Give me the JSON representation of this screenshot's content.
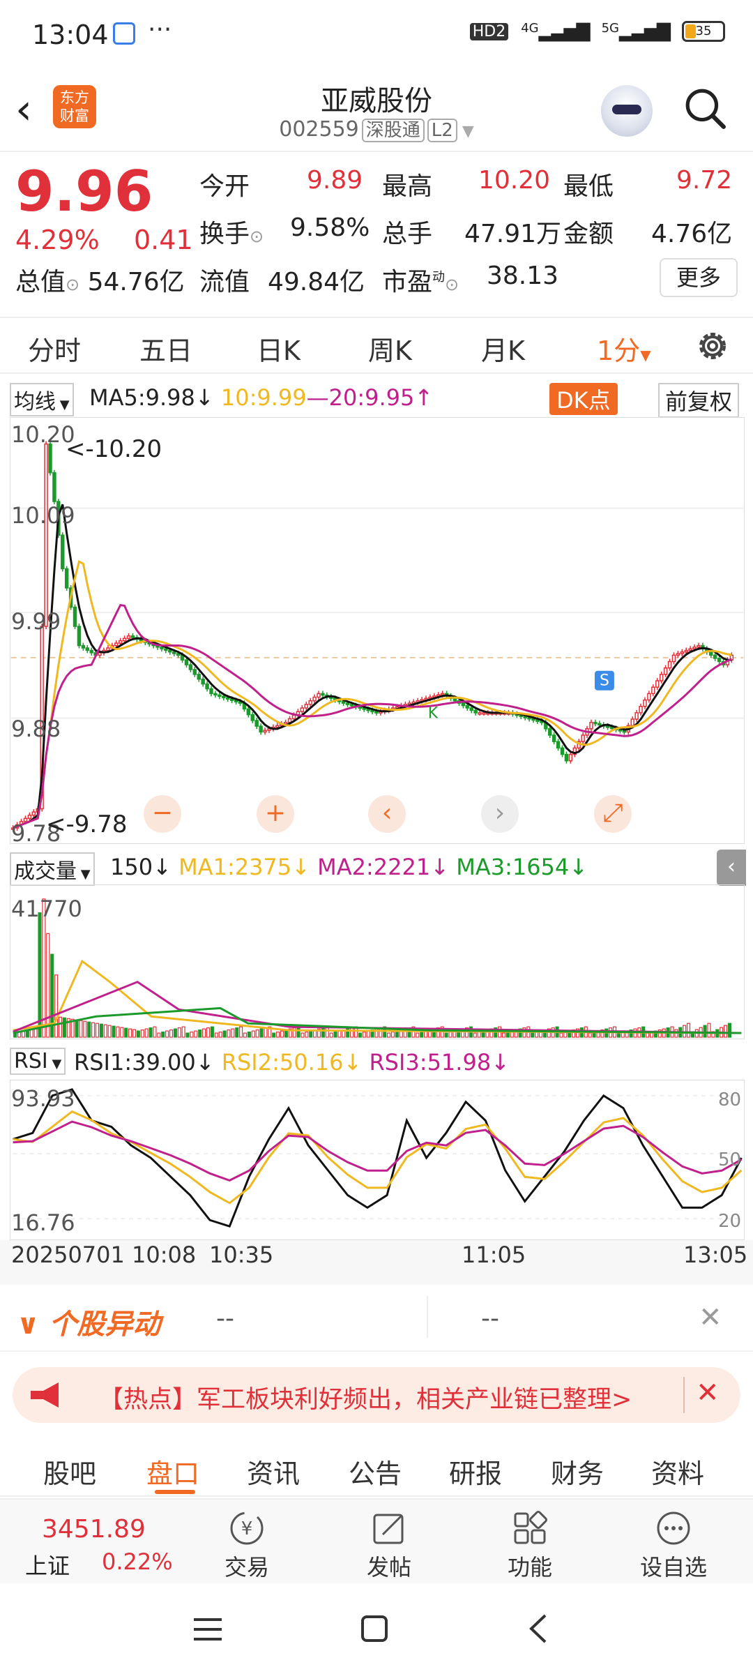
{
  "status_bar": {
    "time": "13:04",
    "dots": "···",
    "network": [
      "HD2",
      "4G",
      "5G"
    ],
    "battery": "35"
  },
  "header": {
    "logo_line1": "东方",
    "logo_line2": "财富",
    "title": "亚威股份",
    "code": "002559",
    "tag": "深股通",
    "level": "L2"
  },
  "quote": {
    "price": "9.96",
    "pct": "4.29%",
    "change": "0.41",
    "open_label": "今开",
    "open": "9.89",
    "high_label": "最高",
    "high": "10.20",
    "low_label": "最低",
    "low": "9.72",
    "turnover_label": "换手",
    "turnover": "9.58%",
    "volume_label": "总手",
    "volume": "47.91万",
    "amount_label": "金额",
    "amount": "4.76亿",
    "mktcap_label": "总值",
    "mktcap": "54.76亿",
    "float_label": "流值",
    "float": "49.84亿",
    "pe_label": "市盈",
    "pe_sup": "动",
    "pe": "38.13",
    "more": "更多"
  },
  "periods": {
    "items": [
      "分时",
      "五日",
      "日K",
      "周K",
      "月K"
    ],
    "active": "1分",
    "active_arrow": "▼"
  },
  "ma_bar": {
    "selector": "均线",
    "ma5": "MA5:9.98",
    "ma5_arrow": "↓",
    "ma10": "10:9.99",
    "ma20": "—20:9.95",
    "ma20_arrow": "↑",
    "dk": "DK点",
    "fq": "前复权"
  },
  "price_chart": {
    "y_labels": [
      "10.20",
      "10.09",
      "9.99",
      "9.88",
      "9.78"
    ],
    "max_label": "<-10.20",
    "min_label": "<-9.78",
    "marker_s": "S",
    "marker_k": "K"
  },
  "controls": {
    "zoom_out": "−",
    "zoom_in": "+",
    "left": "‹",
    "right": "›",
    "expand": "⤢"
  },
  "volume_bar": {
    "selector": "成交量",
    "val": "150",
    "val_arrow": "↓",
    "ma1": "MA1:2375",
    "ma1_arrow": "↓",
    "ma2": "MA2:2221",
    "ma2_arrow": "↓",
    "ma3": "MA3:1654",
    "ma3_arrow": "↓",
    "top_label": "41770",
    "collapse": "‹"
  },
  "rsi_bar": {
    "selector": "RSI",
    "rsi1": "RSI1:39.00",
    "rsi1_arrow": "↓",
    "rsi2": "RSI2:50.16",
    "rsi2_arrow": "↓",
    "rsi3": "RSI3:51.98",
    "rsi3_arrow": "↓",
    "y_top": "93.93",
    "y_bottom": "16.76",
    "r80": "80",
    "r50": "50",
    "r20": "20"
  },
  "x_axis": {
    "start": "20250701 10:08",
    "t1": "10:35",
    "t2": "11:05",
    "t3": "13:05"
  },
  "abnormal": {
    "title": "个股异动",
    "v1": "--",
    "v2": "--",
    "close": "✕"
  },
  "hot": {
    "text": "【热点】军工板块利好频出，相关产业链已整理>",
    "close": "✕"
  },
  "tabs": {
    "items": [
      "股吧",
      "盘口",
      "资讯",
      "公告",
      "研报",
      "财务",
      "资料"
    ],
    "active_index": 1
  },
  "bottom": {
    "index_value": "3451.89",
    "index_name": "上证",
    "index_pct": "0.22%",
    "trade": "交易",
    "post": "发帖",
    "func": "功能",
    "watch": "设自选"
  },
  "colors": {
    "up": "#e0303a",
    "down": "#1a9a2a",
    "ma5": "#111111",
    "ma10": "#f0b820",
    "ma20": "#c0208c",
    "accent": "#f06a24"
  }
}
